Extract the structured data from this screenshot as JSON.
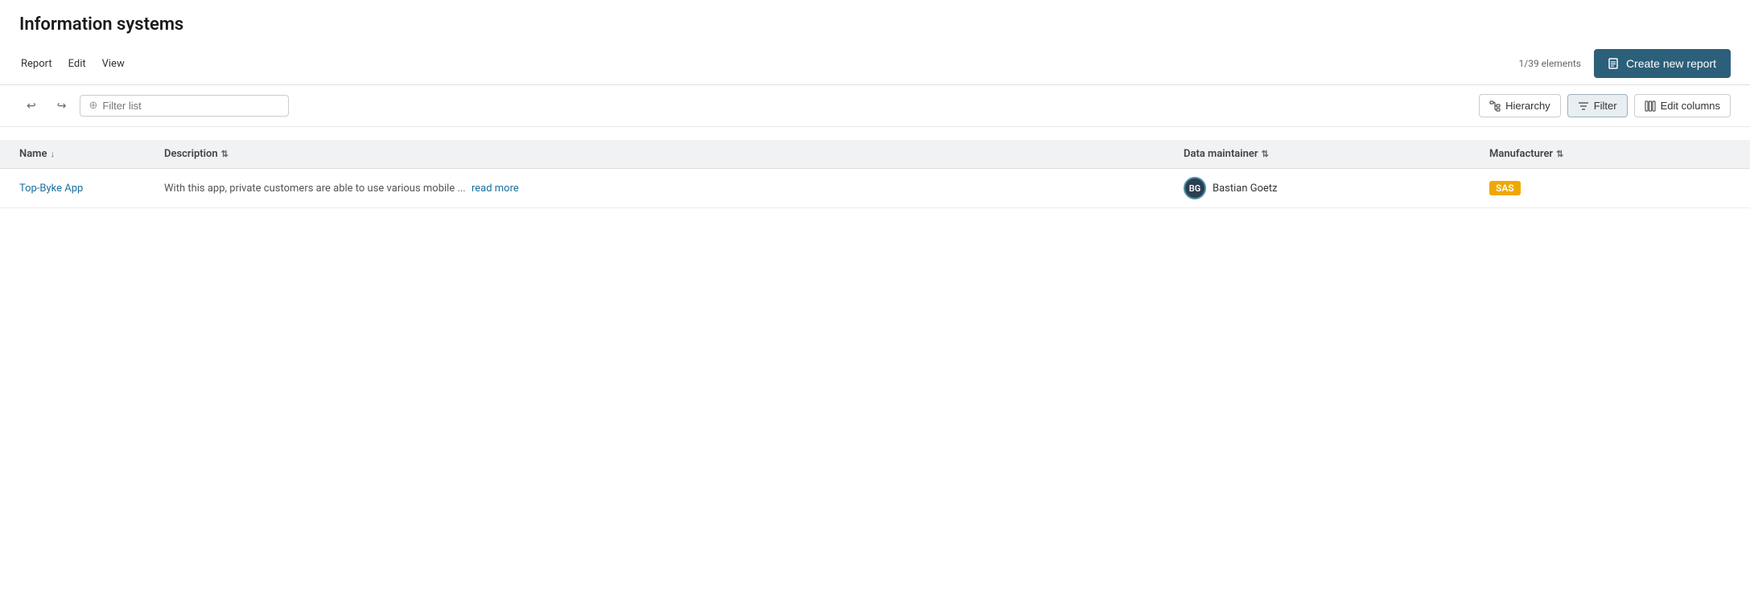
{
  "page": {
    "title": "Information systems",
    "element_count": "1/39 elements"
  },
  "menu": {
    "items": [
      {
        "label": "Report"
      },
      {
        "label": "Edit"
      },
      {
        "label": "View"
      }
    ]
  },
  "toolbar": {
    "create_button_label": "Create new report",
    "undo_icon": "↩",
    "redo_icon": "↪",
    "filter_placeholder": "Filter list",
    "hierarchy_label": "Hierarchy",
    "filter_label": "Filter",
    "edit_columns_label": "Edit columns"
  },
  "table": {
    "columns": [
      {
        "label": "Name",
        "sort": "asc"
      },
      {
        "label": "Description",
        "sort": "both"
      },
      {
        "label": "Data maintainer",
        "sort": "both"
      },
      {
        "label": "Manufacturer",
        "sort": "both"
      }
    ],
    "rows": [
      {
        "name": "Top-Byke App",
        "name_link": "#",
        "description": "With this app, private customers are able to use various mobile ...",
        "read_more": "read more",
        "maintainer_initials": "BG",
        "maintainer_name": "Bastian Goetz",
        "manufacturer": "SAS"
      }
    ]
  }
}
